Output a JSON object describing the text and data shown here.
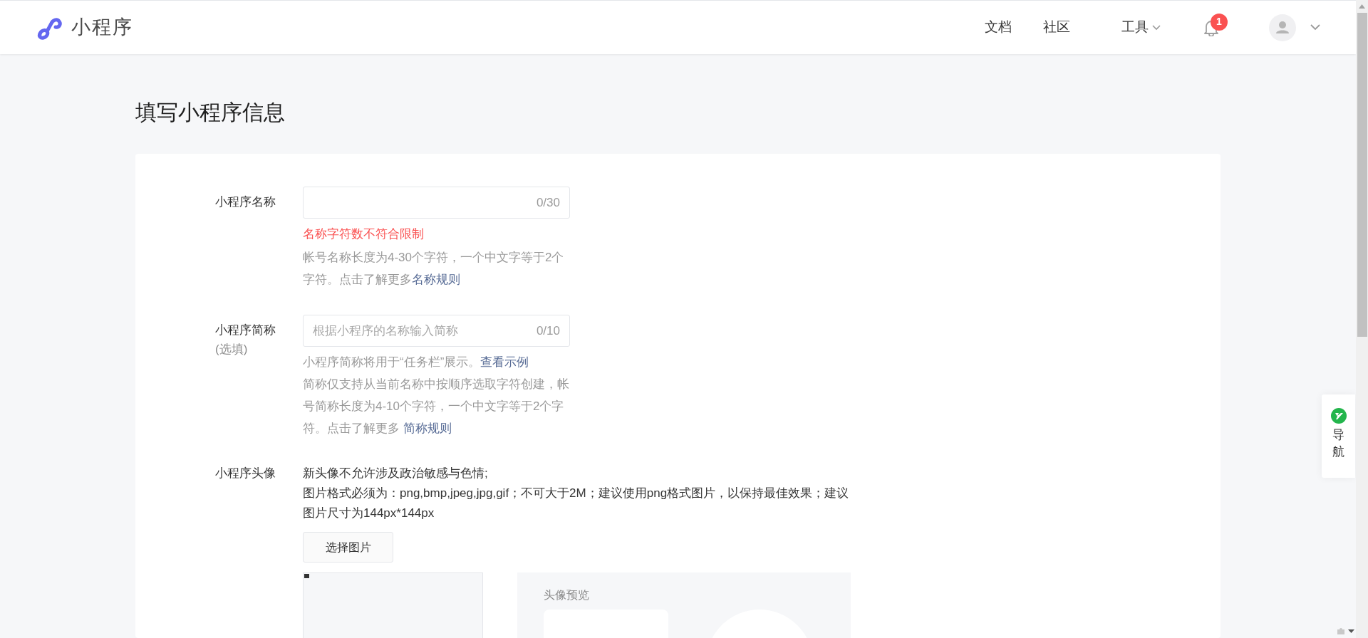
{
  "header": {
    "brand": "小程序",
    "nav": [
      {
        "label": "文档",
        "has_menu": false
      },
      {
        "label": "社区",
        "has_menu": false
      },
      {
        "label": "工具",
        "has_menu": true
      }
    ],
    "notifications": {
      "badge": "1"
    }
  },
  "page_title": "填写小程序信息",
  "form": {
    "fields": [
      {
        "kind": "input",
        "label": "小程序名称",
        "counter": "0/30",
        "error": "名称字符数不符合限制",
        "hints": [
          {
            "text": "帐号名称长度为4-30个字符，一个中文字等于2个字符。点击了解更多",
            "link": "名称规则"
          }
        ]
      },
      {
        "kind": "input",
        "label": "小程序简称",
        "sublabel": "(选填)",
        "placeholder": "根据小程序的名称输入简称",
        "counter": "0/10",
        "hints": [
          {
            "text": "小程序简称将用于“任务栏”展示。",
            "link": "查看示例"
          },
          {
            "text": "简称仅支持从当前名称中按顺序选取字符创建，帐号简称长度为4-10个字符，一个中文字等于2个字符。点击了解更多 ",
            "link": "简称规则"
          }
        ]
      },
      {
        "kind": "avatar",
        "label": "小程序头像",
        "notes": [
          "新头像不允许涉及政治敏感与色情;",
          "图片格式必须为：png,bmp,jpeg,jpg,gif；不可大于2M；建议使用png格式图片，以保持最佳效果；建议图片尺寸为144px*144px"
        ],
        "button": "选择图片",
        "preview_title": "头像预览"
      }
    ]
  },
  "side_nav": {
    "label": "导航"
  }
}
